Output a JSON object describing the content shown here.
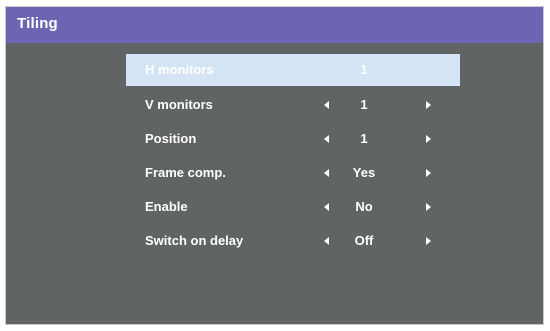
{
  "window": {
    "title": "Tiling"
  },
  "menu": {
    "items": [
      {
        "label": "H monitors",
        "value": "1",
        "selected": true,
        "arrows": false
      },
      {
        "label": "V monitors",
        "value": "1",
        "selected": false,
        "arrows": true
      },
      {
        "label": "Position",
        "value": "1",
        "selected": false,
        "arrows": true
      },
      {
        "label": "Frame comp.",
        "value": "Yes",
        "selected": false,
        "arrows": true
      },
      {
        "label": "Enable",
        "value": "No",
        "selected": false,
        "arrows": true
      },
      {
        "label": "Switch on delay",
        "value": "Off",
        "selected": false,
        "arrows": true
      }
    ]
  },
  "colors": {
    "title_bar": "#6e64b4",
    "background": "#606464",
    "selection": "#d4e4f4",
    "text": "#ffffff"
  },
  "icons": {
    "decrease": "triangle-left-icon",
    "increase": "triangle-right-icon"
  }
}
